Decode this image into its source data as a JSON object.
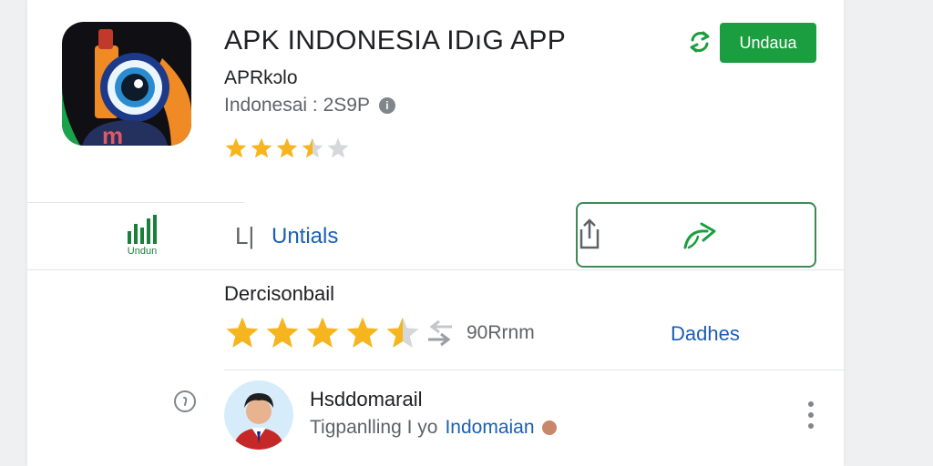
{
  "app": {
    "title": "APK INDONESIA IDıG APP",
    "developer": "APRkɔlo",
    "meta_text": "Indonesai : 2S9P",
    "info_glyph": "i",
    "install_label": "Undaua",
    "small_rating": 3.5
  },
  "tabs": {
    "chart_tab_label": "Undun",
    "pipe_glyph": "L|",
    "active_tab_label": "Untials"
  },
  "ratings": {
    "section_title": "Dercisonbail",
    "big_rating": 4.5,
    "count_text": "90Rrnm",
    "see_all_label": "Dadhes"
  },
  "review": {
    "name": "Hsddomarail",
    "sub_text": "Tigpanlling I yo",
    "sub_link": "Indomaian"
  },
  "colors": {
    "accent_green": "#1a9e3f",
    "link_blue": "#1a5fb4",
    "star": "#f6b51e"
  },
  "icons": {
    "refresh": "refresh-icon",
    "chart": "chart-icon",
    "share": "share-icon",
    "arrow": "arrow-icon",
    "help": "help-icon",
    "more": "more-vert-icon"
  }
}
